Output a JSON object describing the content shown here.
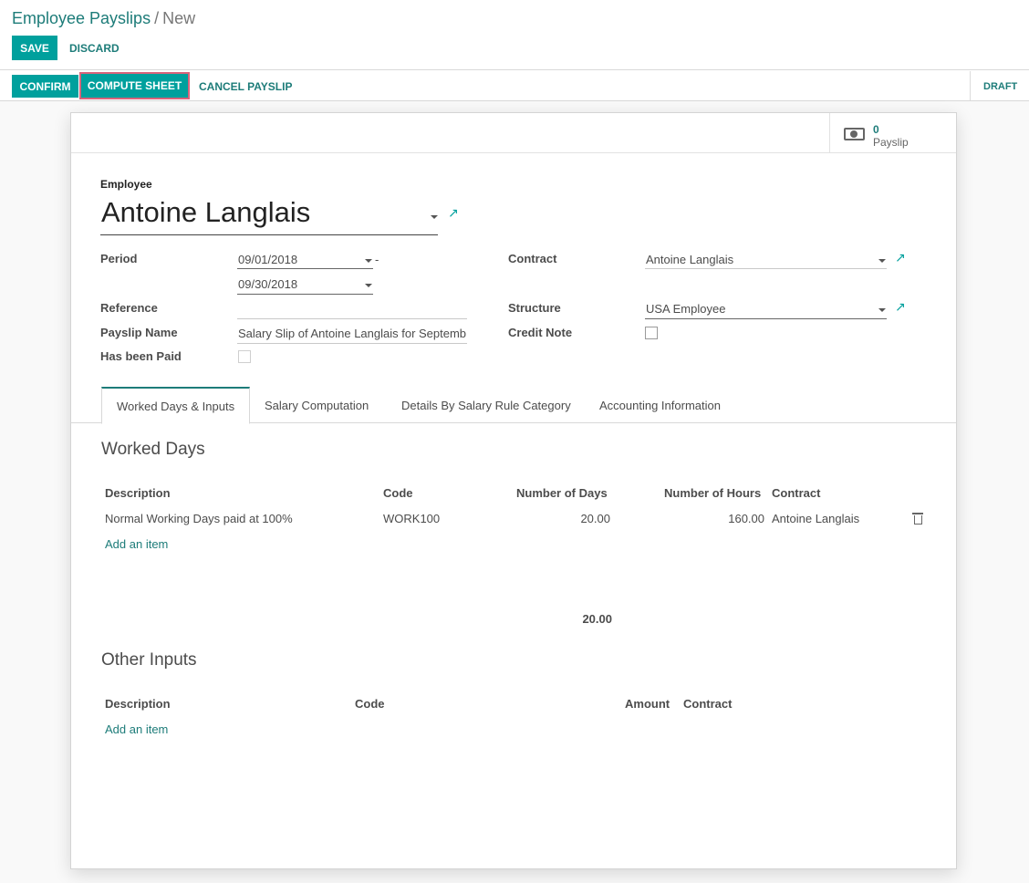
{
  "breadcrumb": {
    "parent": "Employee Payslips",
    "separator": "/",
    "current": "New"
  },
  "toolbar": {
    "save_label": "SAVE",
    "discard_label": "DISCARD"
  },
  "statusbar": {
    "confirm_label": "CONFIRM",
    "compute_label": "COMPUTE SHEET",
    "cancel_label": "CANCEL PAYSLIP",
    "state_label": "DRAFT",
    "highlight_color": "#d9637b"
  },
  "smart_button": {
    "value": "0",
    "label": "Payslip",
    "icon": "money-icon"
  },
  "form": {
    "employee_label": "Employee",
    "employee_name": "Antoine Langlais",
    "period_label": "Period",
    "date_from": "09/01/2018",
    "date_sep": "-",
    "date_to": "09/30/2018",
    "reference_label": "Reference",
    "reference_value": "",
    "payslip_name_label": "Payslip Name",
    "payslip_name_value": "Salary Slip of Antoine Langlais for Septemb",
    "has_been_paid_label": "Has been Paid",
    "contract_label": "Contract",
    "contract_value": "Antoine Langlais",
    "structure_label": "Structure",
    "structure_value": "USA Employee",
    "credit_note_label": "Credit Note"
  },
  "tabs": [
    {
      "label": "Worked Days & Inputs",
      "active": true
    },
    {
      "label": "Salary Computation",
      "active": false
    },
    {
      "label": "Details By Salary Rule Category",
      "active": false
    },
    {
      "label": "Accounting Information",
      "active": false
    }
  ],
  "worked_days": {
    "title": "Worked Days",
    "columns": [
      "Description",
      "Code",
      "Number of Days",
      "Number of Hours",
      "Contract"
    ],
    "rows": [
      {
        "description": "Normal Working Days paid at 100%",
        "code": "WORK100",
        "days": "20.00",
        "hours": "160.00",
        "contract": "Antoine Langlais"
      }
    ],
    "add_item": "Add an item",
    "total_days": "20.00"
  },
  "other_inputs": {
    "title": "Other Inputs",
    "columns": [
      "Description",
      "Code",
      "Amount",
      "Contract"
    ],
    "add_item": "Add an item"
  },
  "colors": {
    "primary": "#00a09d",
    "link": "#1d7c79"
  }
}
